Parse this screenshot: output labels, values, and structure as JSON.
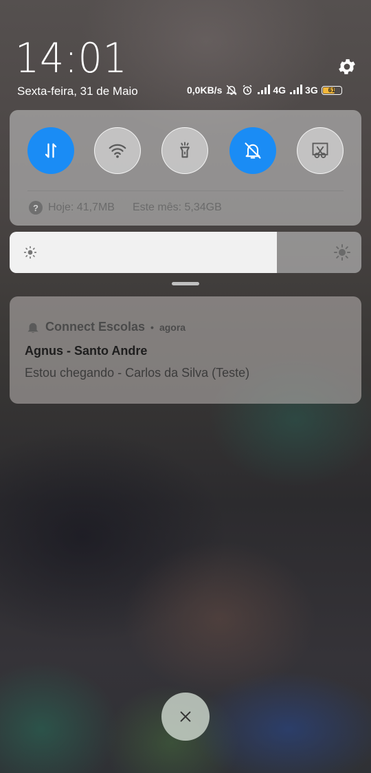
{
  "status_bar": {
    "time": "14:01",
    "date": "Sexta-feira, 31 de Maio",
    "network_speed": "0,0KB/s",
    "network_1": "4G",
    "network_2": "3G",
    "battery_level": "61",
    "icons": [
      "settings-icon",
      "mute-icon",
      "alarm-icon",
      "signal-icon",
      "signal-icon",
      "battery-icon"
    ]
  },
  "quick_settings": {
    "toggles": [
      {
        "name": "mobile-data",
        "icon": "data-transfer-icon",
        "state": "on"
      },
      {
        "name": "wifi",
        "icon": "wifi-icon",
        "state": "off"
      },
      {
        "name": "flashlight",
        "icon": "flashlight-icon",
        "state": "off"
      },
      {
        "name": "mute",
        "icon": "bell-off-icon",
        "state": "on"
      },
      {
        "name": "screenshot",
        "icon": "scissors-icon",
        "state": "off"
      }
    ],
    "data_usage": {
      "today": "Hoje: 41,7MB",
      "month": "Este mês: 5,34GB"
    }
  },
  "brightness": {
    "level": 0.76
  },
  "notification": {
    "app_name": "Connect Escolas",
    "time": "agora",
    "title": "Agnus - Santo Andre",
    "text": "Estou chegando - Carlos da Silva (Teste)"
  },
  "colors": {
    "accent": "#1a8cf5",
    "battery": "#f2b63a"
  }
}
